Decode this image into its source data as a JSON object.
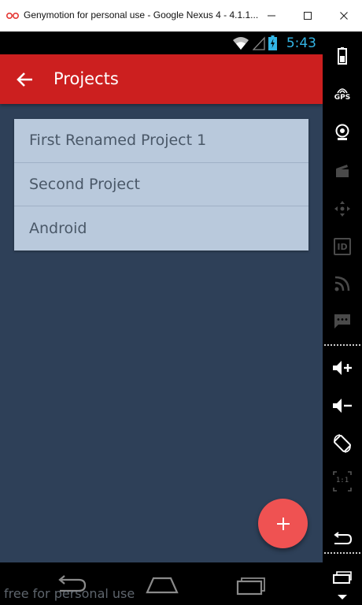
{
  "window": {
    "title": "Genymotion for personal use - Google Nexus 4 - 4.1.1...",
    "minimize_glyph": "—",
    "maximize_glyph": "☐",
    "close_glyph": "✕"
  },
  "status_bar": {
    "time": "5:43",
    "accent": "#33b5e5"
  },
  "app_bar": {
    "title": "Projects",
    "color": "#cc1f1f"
  },
  "projects": [
    "First Renamed Project 1",
    "Second Project",
    "Android"
  ],
  "fab": {
    "label": "+",
    "color": "#ef5252"
  },
  "watermark": "free for personal use",
  "side_toolbar": {
    "gps_label": "GPS",
    "id_label": "ID",
    "scale_label": "1:1",
    "icons": [
      "battery-icon",
      "gps-icon",
      "webcam-icon",
      "clapper-icon",
      "dpad-icon",
      "id-icon",
      "rss-icon",
      "sms-icon",
      "volume-up-icon",
      "volume-down-icon",
      "rotate-icon",
      "scale-icon",
      "back-icon",
      "recent-apps-icon",
      "menu-icon"
    ]
  }
}
